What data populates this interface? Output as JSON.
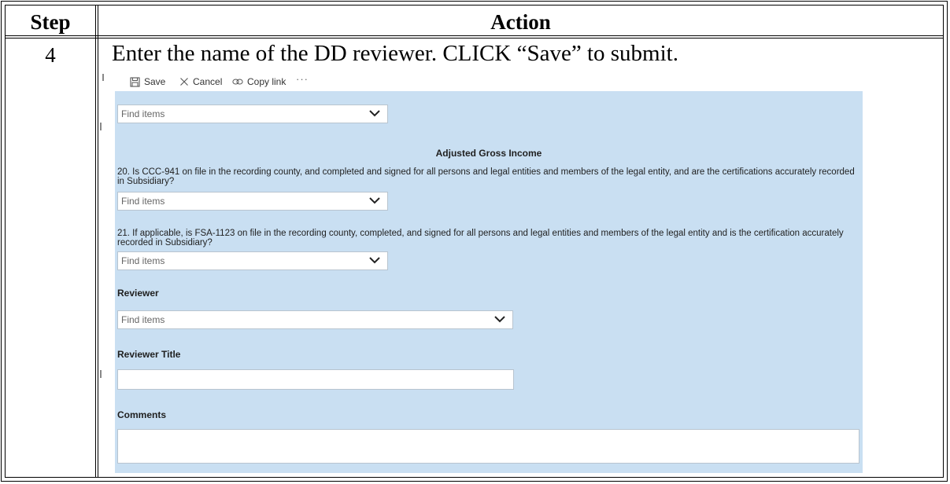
{
  "table": {
    "header_step": "Step",
    "header_action": "Action",
    "rows": [
      {
        "step": "4",
        "action_text": "Enter the name of the DD reviewer.  CLICK “Save” to submit."
      }
    ]
  },
  "toolbar": {
    "save_label": "Save",
    "cancel_label": "Cancel",
    "copy_link_label": "Copy link",
    "more_label": "···"
  },
  "form": {
    "top_dropdown_placeholder": "Find items",
    "section_title": "Adjusted Gross Income",
    "q20_text": "20.  Is CCC-941 on file in the recording county, and completed and signed for all persons and legal entities and members of the legal entity, and are the certifications accurately recorded in Subsidiary?",
    "q20_placeholder": "Find items",
    "q21_text": "21.  If applicable, is FSA-1123 on file in the recording county, completed, and signed for all persons and legal entities and members of the legal entity and is the certification accurately recorded in Subsidiary?",
    "q21_placeholder": "Find items",
    "reviewer_label": "Reviewer",
    "reviewer_placeholder": "Find items",
    "reviewer_title_label": "Reviewer Title",
    "reviewer_title_value": "",
    "comments_label": "Comments",
    "comments_value": ""
  },
  "colors": {
    "form_background": "#c9dff2",
    "undo_icon": "#3a8fd6"
  },
  "icons": [
    "save-icon",
    "cancel-icon",
    "copy-link-icon",
    "more-icon",
    "chevron-down-icon",
    "undo-icon"
  ]
}
